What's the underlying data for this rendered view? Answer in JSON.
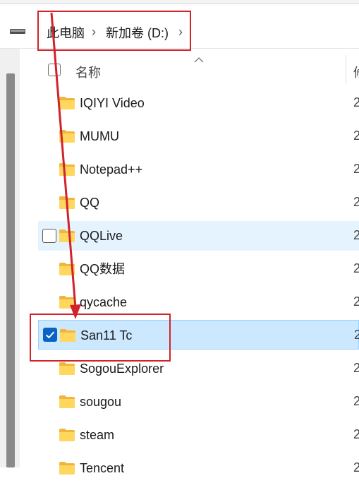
{
  "breadcrumb": {
    "items": [
      "此电脑",
      "新加卷 (D:)"
    ],
    "separator": "›",
    "trailing_chevron": "›"
  },
  "header": {
    "name_label": "名称",
    "second_col_partial": "修"
  },
  "rows": [
    {
      "name": "IQIYI Video",
      "date_partial": "2",
      "state": "normal"
    },
    {
      "name": "MUMU",
      "date_partial": "2",
      "state": "normal"
    },
    {
      "name": "Notepad++",
      "date_partial": "2",
      "state": "normal"
    },
    {
      "name": "QQ",
      "date_partial": "2",
      "state": "normal"
    },
    {
      "name": "QQLive",
      "date_partial": "2",
      "state": "hover"
    },
    {
      "name": "QQ数据",
      "date_partial": "2",
      "state": "normal"
    },
    {
      "name": "qycache",
      "date_partial": "2",
      "state": "normal"
    },
    {
      "name": "San11 Tc",
      "date_partial": "2",
      "state": "selected"
    },
    {
      "name": "SogouExplorer",
      "date_partial": "2",
      "state": "normal"
    },
    {
      "name": "sougou",
      "date_partial": "2",
      "state": "normal"
    },
    {
      "name": "steam",
      "date_partial": "2",
      "state": "normal"
    },
    {
      "name": "Tencent",
      "date_partial": "2",
      "state": "normal"
    }
  ],
  "colors": {
    "annotation": "#d0232a",
    "selected_bg": "#cce8ff",
    "hover_bg": "#e5f3ff",
    "folder": "#ffd75e",
    "checkbox_checked": "#0a62c2"
  },
  "icons": {
    "drive": "drive-icon",
    "folder": "folder-icon",
    "sort": "sort-ascending-icon",
    "check": "checkmark-icon"
  }
}
